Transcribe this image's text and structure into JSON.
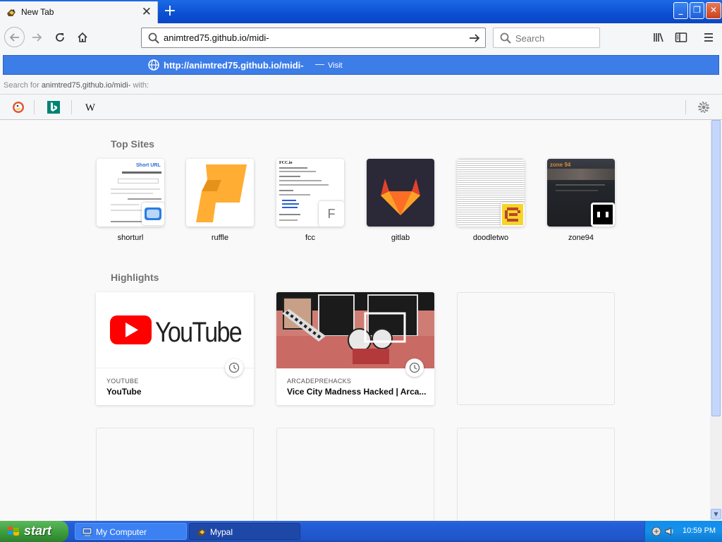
{
  "browser": {
    "tab": {
      "title": "New Tab",
      "close_label": "✕"
    },
    "new_tab_label": "+",
    "window_controls": {
      "minimize": "_",
      "restore": "❐",
      "close": "✕"
    }
  },
  "navbar": {
    "url_value": "animtred75.github.io/midi-",
    "search_placeholder": "Search"
  },
  "dropdown": {
    "suggestion_url": "http://animtred75.github.io/midi-",
    "suggestion_sep": "—",
    "suggestion_action": "Visit",
    "search_for_prefix": "Search for",
    "search_for_query": "animtred75.github.io/midi-",
    "search_for_suffix": "with:",
    "engines": [
      "duckduckgo-icon",
      "bing-icon",
      "wikipedia-icon"
    ]
  },
  "newtab": {
    "top_sites_title": "Top Sites",
    "top_sites": [
      {
        "label": "shorturl"
      },
      {
        "label": "ruffle"
      },
      {
        "label": "fcc",
        "fallback_letter": "F"
      },
      {
        "label": "gitlab"
      },
      {
        "label": "doodletwo"
      },
      {
        "label": "zone94"
      }
    ],
    "highlights_title": "Highlights",
    "highlights": [
      {
        "source": "YOUTUBE",
        "title": "YouTube"
      },
      {
        "source": "ARCADEPREHACKS",
        "title": "Vice City Madness Hacked | Arca..."
      }
    ],
    "shorturl_thumb_heading": "Short URL",
    "gitlab_color": "#e24329",
    "ruffle_color": "#ffad33"
  },
  "taskbar": {
    "start_label": "start",
    "items": [
      {
        "label": "My Computer"
      },
      {
        "label": "Mypal"
      }
    ],
    "clock": "10:59 PM"
  }
}
